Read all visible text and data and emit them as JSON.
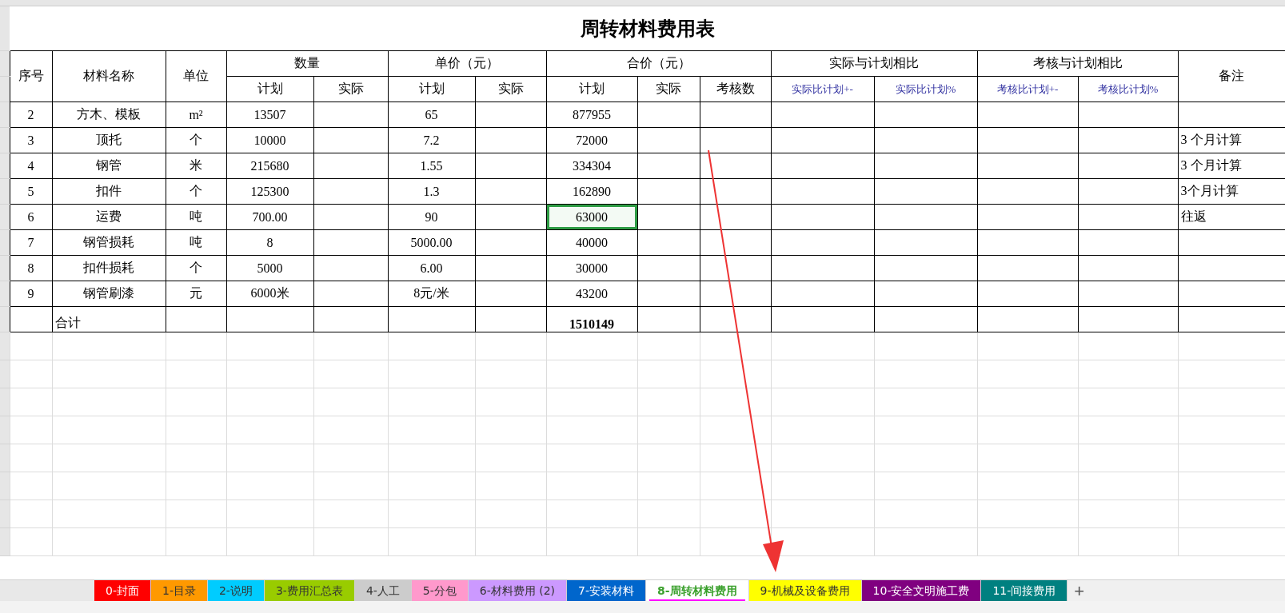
{
  "title": "周转材料费用表",
  "header_groups": [
    {
      "label": "序号"
    },
    {
      "label": "材料名称"
    },
    {
      "label": "单位"
    },
    {
      "label": "数量",
      "children": [
        {
          "label": "计划",
          "kind": "plain"
        },
        {
          "label": "实际",
          "kind": "plain"
        }
      ]
    },
    {
      "label": "单价（元）",
      "children": [
        {
          "label": "计划",
          "kind": "plain"
        },
        {
          "label": "实际",
          "kind": "plain"
        }
      ]
    },
    {
      "label": "合价（元）",
      "children": [
        {
          "label": "计划",
          "kind": "plain"
        },
        {
          "label": "实际",
          "kind": "plain"
        },
        {
          "label": "考核数",
          "kind": "plain"
        }
      ]
    },
    {
      "label": "实际与计划相比",
      "children": [
        {
          "label": "实际比计划+-",
          "kind": "compare"
        },
        {
          "label": "实际比计划%",
          "kind": "compare"
        }
      ]
    },
    {
      "label": "考核与计划相比",
      "children": [
        {
          "label": "考核比计划+-",
          "kind": "compare"
        },
        {
          "label": "考核比计划%",
          "kind": "compare"
        }
      ]
    },
    {
      "label": "备注"
    }
  ],
  "rows": [
    {
      "no": "2",
      "name": "方木、模板",
      "unit": "m²",
      "qty_plan": "13507",
      "price_plan": "65",
      "total_plan": "877955",
      "note": "",
      "total_selected": false
    },
    {
      "no": "3",
      "name": "顶托",
      "unit": "个",
      "qty_plan": "10000",
      "price_plan": "7.2",
      "total_plan": "72000",
      "note": "3 个月计算",
      "total_selected": false
    },
    {
      "no": "4",
      "name": "钢管",
      "unit": "米",
      "qty_plan": "215680",
      "price_plan": "1.55",
      "total_plan": "334304",
      "note": "3 个月计算",
      "total_selected": false
    },
    {
      "no": "5",
      "name": "扣件",
      "unit": "个",
      "qty_plan": "125300",
      "price_plan": "1.3",
      "total_plan": "162890",
      "note": "3个月计算",
      "total_selected": false
    },
    {
      "no": "6",
      "name": "运费",
      "unit": "吨",
      "qty_plan": "700.00",
      "price_plan": "90",
      "total_plan": "63000",
      "note": "往返",
      "total_selected": true
    },
    {
      "no": "7",
      "name": "钢管损耗",
      "unit": "吨",
      "qty_plan": "8",
      "price_plan": "5000.00",
      "total_plan": "40000",
      "note": "",
      "total_selected": false
    },
    {
      "no": "8",
      "name": "扣件损耗",
      "unit": "个",
      "qty_plan": "5000",
      "price_plan": "6.00",
      "total_plan": "30000",
      "note": "",
      "total_selected": false
    },
    {
      "no": "9",
      "name": "钢管刷漆",
      "unit": "元",
      "qty_plan": "6000米",
      "price_plan": "8元/米",
      "total_plan": "43200",
      "note": "",
      "total_selected": false
    }
  ],
  "total_row": {
    "label": "合计",
    "total_plan": "1510149"
  },
  "sheet_tabs": [
    {
      "label": "0-封面",
      "color": "#ff0000",
      "selected": false
    },
    {
      "label": "1-目录",
      "color": "#ff9900",
      "selected": false
    },
    {
      "label": "2-说明",
      "color": "#00ccff",
      "selected": false
    },
    {
      "label": "3-费用汇总表",
      "color": "#99cc00",
      "selected": false
    },
    {
      "label": "4-人工",
      "color": "#cccccc",
      "selected": false
    },
    {
      "label": "5-分包",
      "color": "#ff99cc",
      "selected": false
    },
    {
      "label": "6-材料费用 (2)",
      "color": "#cc99ff",
      "selected": false
    },
    {
      "label": "7-安装材料",
      "color": "#0066cc",
      "selected": false
    },
    {
      "label": "8-周转材料费用",
      "color": "#ff00ff",
      "selected": true
    },
    {
      "label": "9-机械及设备费用",
      "color": "#ffff00",
      "selected": false
    },
    {
      "label": "10-安全文明施工费",
      "color": "#800080",
      "selected": false
    },
    {
      "label": "11-间接费用",
      "color": "#008080",
      "selected": false
    }
  ],
  "add_sheet": "+"
}
